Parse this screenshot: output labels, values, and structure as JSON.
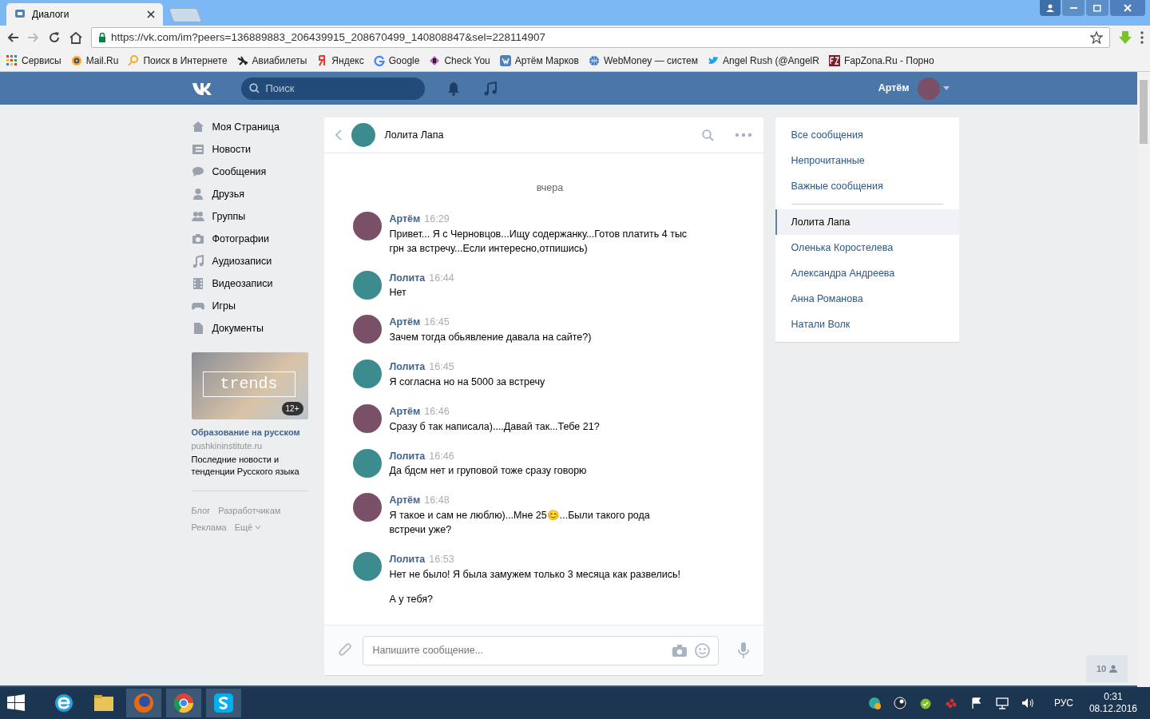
{
  "browser": {
    "tab_title": "Диалоги",
    "url": "https://vk.com/im?peers=136889883_206439915_208670499_140808847&sel=228114907",
    "bookmarks": [
      {
        "label": "Сервисы",
        "kind": "apps"
      },
      {
        "label": "Mail.Ru",
        "kind": "at"
      },
      {
        "label": "Поиск в Интернете",
        "kind": "search"
      },
      {
        "label": "Авиабилеты",
        "kind": "plane"
      },
      {
        "label": "Яндекс",
        "kind": "letter"
      },
      {
        "label": "Google",
        "kind": "g"
      },
      {
        "label": "Check You",
        "kind": "money"
      },
      {
        "label": "Артём Марков",
        "kind": "vk"
      },
      {
        "label": "WebMoney — систем",
        "kind": "globe"
      },
      {
        "label": "Angel Rush (@AngelR",
        "kind": "bird"
      },
      {
        "label": "FapZona.Ru - Порно",
        "kind": "fz"
      }
    ]
  },
  "header": {
    "search_placeholder": "Поиск",
    "user_name": "Артём"
  },
  "menu": [
    {
      "label": "Моя Страница",
      "kind": "home"
    },
    {
      "label": "Новости",
      "kind": "news"
    },
    {
      "label": "Сообщения",
      "kind": "chat"
    },
    {
      "label": "Друзья",
      "kind": "person"
    },
    {
      "label": "Группы",
      "kind": "people"
    },
    {
      "label": "Фотографии",
      "kind": "camera"
    },
    {
      "label": "Аудиозаписи",
      "kind": "note"
    },
    {
      "label": "Видеозаписи",
      "kind": "film"
    },
    {
      "label": "Игры",
      "kind": "gamepad"
    },
    {
      "label": "Документы",
      "kind": "doc"
    }
  ],
  "ad": {
    "image_text": "trends",
    "age": "12+",
    "title": "Образование на русском",
    "domain": "pushkininstitute.ru",
    "text": "Последние новости и тенденции Русского языка"
  },
  "footer_links": [
    "Блог",
    "Разработчикам",
    "Реклама",
    "Ещё"
  ],
  "chat": {
    "title": "Лолита Лапа",
    "date_label": "вчера",
    "messages": [
      {
        "author": "Артём",
        "time": "16:29",
        "kind": "outgoing",
        "texts": [
          "Привет... Я с Черновцов...Ищу содержанку...Готов платить 4 тыс грн за встречу...Если интересно,отпишись)"
        ]
      },
      {
        "author": "Лолита",
        "time": "16:44",
        "kind": "incoming",
        "texts": [
          "Нет"
        ]
      },
      {
        "author": "Артём",
        "time": "16:45",
        "kind": "outgoing",
        "texts": [
          "Зачем тогда обьявление давала на сайте?)"
        ]
      },
      {
        "author": "Лолита",
        "time": "16:45",
        "kind": "incoming",
        "texts": [
          "Я согласна но на 5000 за встречу"
        ]
      },
      {
        "author": "Артём",
        "time": "16:46",
        "kind": "outgoing",
        "texts": [
          "Сразу б так написала)....Давай так...Тебе 21?"
        ]
      },
      {
        "author": "Лолита",
        "time": "16:46",
        "kind": "incoming",
        "texts": [
          "Да бдсм нет и груповой тоже сразу говорю"
        ]
      },
      {
        "author": "Артём",
        "time": "16:48",
        "kind": "outgoing",
        "texts": [
          "Я такое и сам не люблю)...Мне 25😊...Были такого рода встречи уже?"
        ]
      },
      {
        "author": "Лолита",
        "time": "16:53",
        "kind": "incoming",
        "texts": [
          "Нет не было! Я была замужем только 3 месяца как развелись!",
          "А у тебя?"
        ]
      }
    ],
    "composer_placeholder": "Напишите сообщение..."
  },
  "filters": [
    {
      "label": "Все сообщения",
      "selected": false
    },
    {
      "label": "Непрочитанные",
      "selected": false
    },
    {
      "label": "Важные сообщения",
      "selected": false
    }
  ],
  "dialogs": [
    {
      "label": "Лолита Лапа",
      "selected": true
    },
    {
      "label": "Оленька Коростелева",
      "selected": false
    },
    {
      "label": "Александра Андреева",
      "selected": false
    },
    {
      "label": "Анна Романова",
      "selected": false
    },
    {
      "label": "Натали Волк",
      "selected": false
    }
  ],
  "online_count": "10",
  "taskbar": {
    "language": "РУС",
    "time": "0:31",
    "date": "08.12.2016"
  }
}
